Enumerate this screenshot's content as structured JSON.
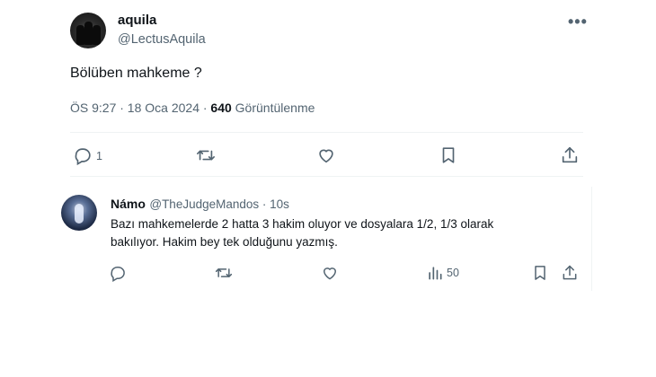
{
  "post": {
    "name": "aquila",
    "handle": "@LectusAquila",
    "more": "•••",
    "text": "Bölüben mahkeme ?",
    "time": "ÖS 9:27 · 18 Oca 2024 ·",
    "views_count": "640",
    "views_label": "Görüntülenme",
    "actions": {
      "reply_count": "1",
      "reply_icon": "reply-icon",
      "repost_icon": "repost-icon",
      "like_icon": "heart-icon",
      "bookmark_icon": "bookmark-icon",
      "share_icon": "share-icon"
    }
  },
  "reply": {
    "name": "Námo",
    "handle": "@TheJudgeMandos · 10s",
    "text_line1": "Bazı mahkemelerde 2 hatta 3 hakim oluyor ve dosyalara 1/2, 1/3 olarak",
    "text_line2": "bakılıyor. Hakim bey tek olduğunu yazmış.",
    "views_count": "50"
  }
}
